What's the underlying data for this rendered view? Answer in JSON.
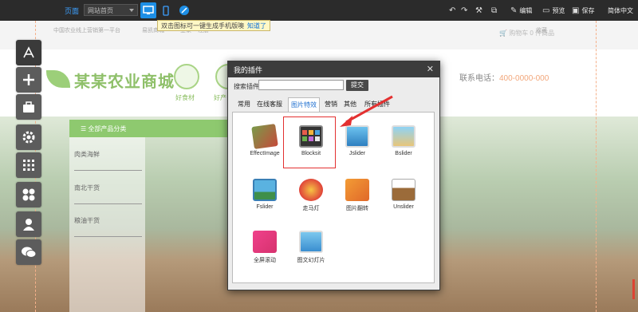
{
  "toolbar": {
    "page_label": "页面",
    "page_select_value": "网站首页",
    "edit_label": "编辑",
    "preview_label": "预览",
    "save_label": "保存",
    "language_label": "简体中文"
  },
  "tooltip": {
    "text": "双击图标可一键生成手机版噢",
    "link": "知道了"
  },
  "site": {
    "topline_left": "中国农业线上营销第一平台",
    "topline_home": "易凯商城",
    "topline_login": "登录",
    "topline_register": "注册",
    "logo_text": "某某农业商城",
    "cat_labels": [
      "好食材",
      "好产"
    ],
    "hotline_label": "联系电话：",
    "hotline_number": "400-0000-000",
    "cart_label": "购物车 0 件商品",
    "favorite_label": "收藏",
    "menu_title": "全部产品分类",
    "menu_items": [
      "肉类海鲜",
      "南北干货",
      "粮油干货"
    ]
  },
  "dialog": {
    "title": "我的插件",
    "search_label": "搜索插件",
    "search_placeholder": "",
    "search_button": "提交",
    "tabs": [
      "常用",
      "在线客服",
      "图片特效",
      "营销",
      "其他",
      "所有插件"
    ],
    "active_tab": "图片特效",
    "plugins": [
      {
        "label": "EffectImage"
      },
      {
        "label": "Blocksit"
      },
      {
        "label": "Jslider"
      },
      {
        "label": "Bslider"
      },
      {
        "label": "Fslider"
      },
      {
        "label": "走马灯"
      },
      {
        "label": "图片翻转"
      },
      {
        "label": "Unslider"
      },
      {
        "label": "全屏滚动"
      },
      {
        "label": "图文幻灯片"
      }
    ]
  },
  "colors": {
    "accent": "#1e8fe6",
    "highlight": "#e33030",
    "site_green": "#8ec96f",
    "hotline_orange": "#f2a77b"
  }
}
